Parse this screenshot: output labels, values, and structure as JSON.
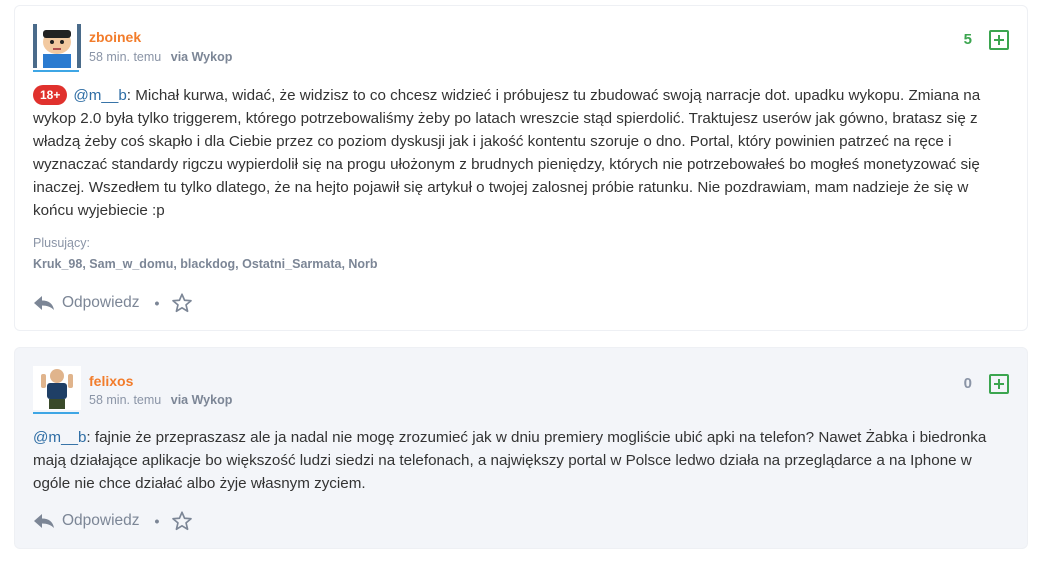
{
  "comments": [
    {
      "author": "zboinek",
      "time": "58 min. temu",
      "via": "via Wykop",
      "votes": "5",
      "badge": "18+",
      "mention": "@m__b",
      "text": ": Michał kurwa, widać, że widzisz to co chcesz widzieć i próbujesz tu zbudować swoją narracje dot. upadku wykopu. Zmiana na wykop 2.0 była tylko triggerem, którego potrzebowaliśmy żeby po latach wreszcie stąd spierdolić. Traktujesz userów jak gówno, bratasz się z władzą żeby coś skapło i dla Ciebie przez co poziom dyskusji jak i jakość kontentu szoruje o dno. Portal, który powinien patrzeć na ręce i wyznaczać standardy rigczu wypierdolił się na progu ułożonym z brudnych pieniędzy, których nie potrzebowałeś bo mogłeś monetyzować się inaczej. Wszedłem tu tylko dlatego, że na hejto pojawił się artykuł o twojej zalosnej próbie ratunku. Nie pozdrawiam, mam nadzieje że się w końcu wyjebiecie :p",
      "voters_label": "Plusujący:",
      "voters": "Kruk_98, Sam_w_domu, blackdog, Ostatni_Sarmata, Norb",
      "reply_label": "Odpowiedz",
      "dot": "•"
    },
    {
      "author": "felixos",
      "time": "58 min. temu",
      "via": "via Wykop",
      "votes": "0",
      "mention": "@m__b",
      "text": ": fajnie że przepraszasz ale ja nadal nie mogę zrozumieć jak w dniu premiery mogliście ubić apki na telefon? Nawet Żabka i biedronka mają działające aplikacje bo większość ludzi siedzi na telefonach, a największy portal w Polsce ledwo działa na przeglądarce a na Iphone w ogóle nie chce działać albo żyje własnym zyciem.",
      "reply_label": "Odpowiedz",
      "dot": "•"
    }
  ],
  "icons": {
    "vote": "plus-square-icon",
    "reply": "reply-arrow-icon",
    "favorite": "star-outline-icon"
  },
  "colors": {
    "author": "#f27c2b",
    "vote_positive": "#3ba54f",
    "badge": "#e0312d",
    "mention": "#2e6da4",
    "avatar_underline": "#3ea6e5"
  }
}
